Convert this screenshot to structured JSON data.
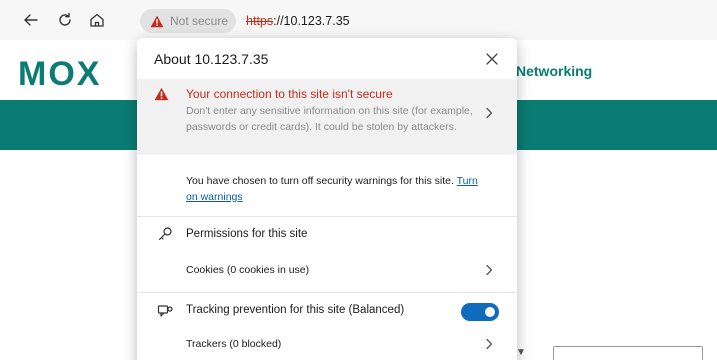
{
  "toolbar": {
    "security_label": "Not secure",
    "url_scheme": "https",
    "url_rest": "://10.123.7.35",
    "icons": [
      "back-icon",
      "refresh-icon",
      "home-icon",
      "warning-icon"
    ]
  },
  "page": {
    "logo": "MOX",
    "nav_text": "Networking"
  },
  "popup": {
    "title": "About 10.123.7.35",
    "warning_title": "Your connection to this site isn't secure",
    "warning_desc": "Don't enter any sensitive information on this site (for example, passwords or credit cards). It could be stolen by attackers.",
    "info_text": "You have chosen to turn off security warnings for this site.",
    "info_link": "Turn on warnings",
    "permissions_label": "Permissions for this site",
    "cookies_label": "Cookies (0 cookies in use)",
    "tracking_label": "Tracking prevention for this site (Balanced)",
    "tracking_enabled": true,
    "trackers_label": "Trackers (0 blocked)"
  },
  "colors": {
    "brand_teal": "#0b7c73",
    "warning_red": "#c42b1c",
    "toggle_blue": "#0f6cbd",
    "link_blue": "#0b5cad"
  }
}
